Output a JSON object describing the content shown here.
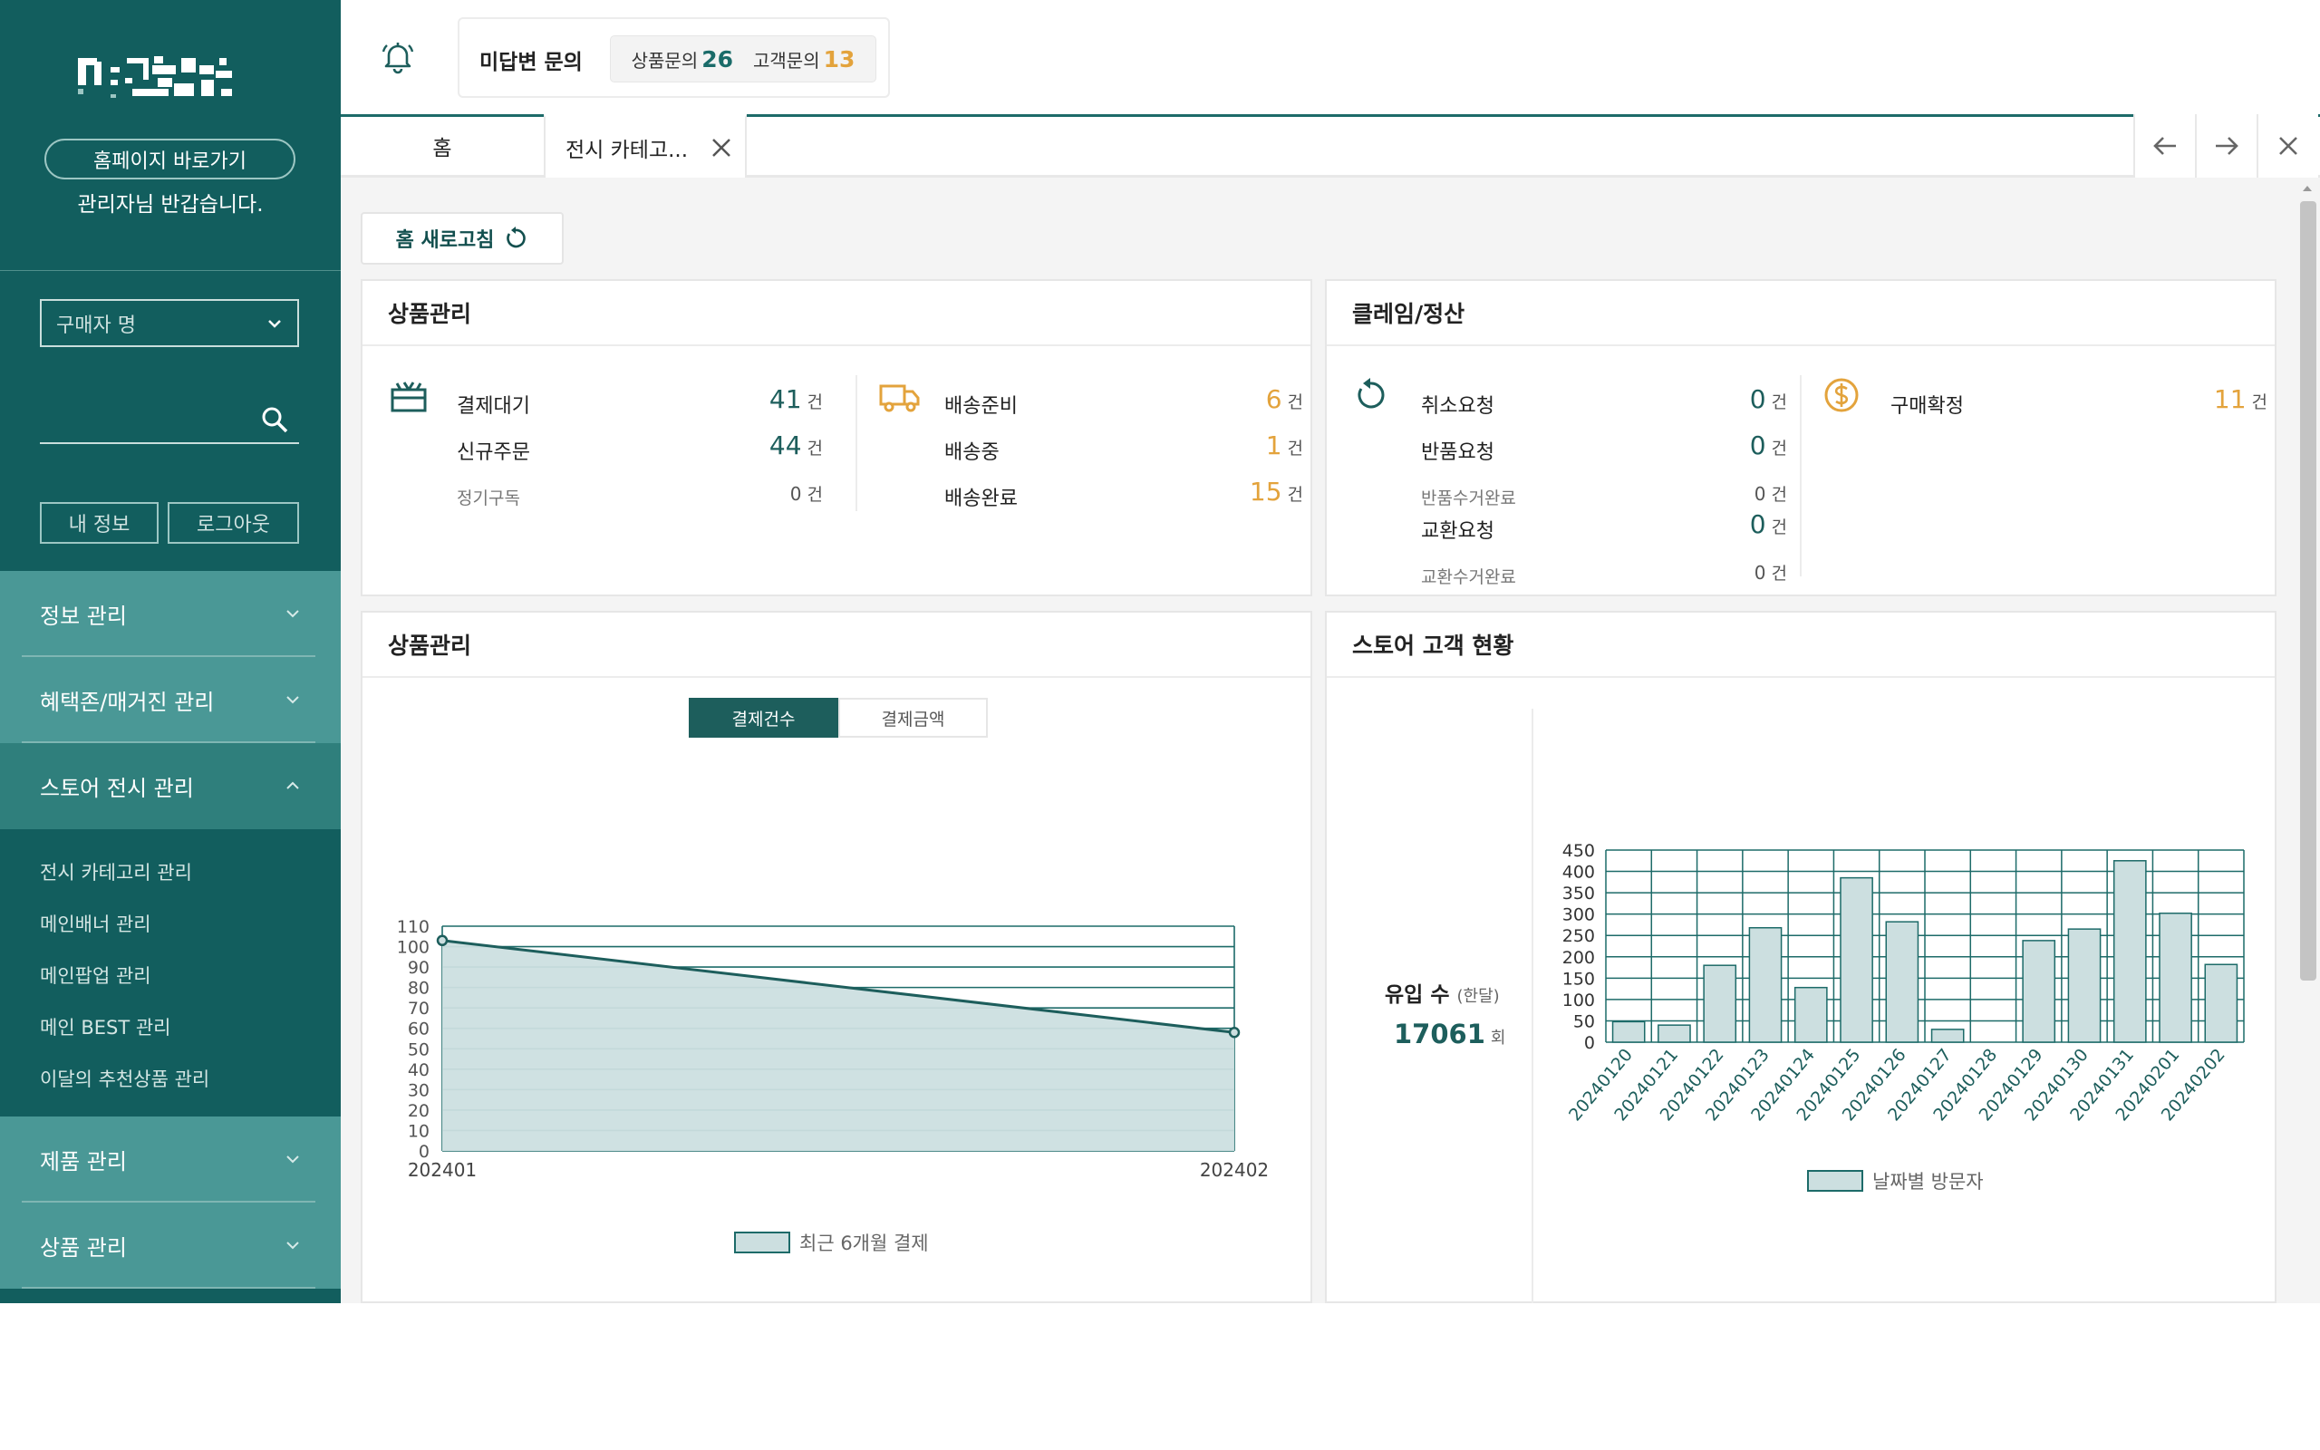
{
  "sidebar": {
    "home_link": "홈페이지 바로가기",
    "welcome": "관리자님 반갑습니다.",
    "buyer_select": "구매자 명",
    "my_info": "내 정보",
    "logout": "로그아웃",
    "menu": [
      {
        "label": "정보 관리",
        "expanded": false
      },
      {
        "label": "혜택존/매거진 관리",
        "expanded": false
      },
      {
        "label": "스토어 전시 관리",
        "expanded": true,
        "children": [
          "전시 카테고리 관리",
          "메인배너 관리",
          "메인팝업 관리",
          "메인 BEST 관리",
          "이달의 추천상품 관리"
        ]
      },
      {
        "label": "제품 관리",
        "expanded": false
      },
      {
        "label": "상품 관리",
        "expanded": false
      }
    ]
  },
  "topbar": {
    "unanswered_title": "미답변 문의",
    "product_inquiry_label": "상품문의",
    "product_inquiry_count": "26",
    "customer_inquiry_label": "고객문의",
    "customer_inquiry_count": "13"
  },
  "tabs": {
    "home": "홈",
    "category": "전시 카테고..."
  },
  "refresh_label": "홈 새로고침",
  "product_card": {
    "title": "상품관리",
    "unit": "건",
    "rows": [
      {
        "label": "결제대기",
        "value": "41"
      },
      {
        "label": "신규주문",
        "value": "44"
      },
      {
        "label": "정기구독",
        "value": "0"
      }
    ],
    "shipping": [
      {
        "label": "배송준비",
        "value": "6"
      },
      {
        "label": "배송중",
        "value": "1"
      },
      {
        "label": "배송완료",
        "value": "15"
      }
    ]
  },
  "claim_card": {
    "title": "클레임/정산",
    "unit": "건",
    "rows": [
      {
        "label": "취소요청",
        "value": "0"
      },
      {
        "label": "반품요청",
        "value": "0"
      },
      {
        "label": "반품수거완료",
        "value": "0"
      },
      {
        "label": "교환요청",
        "value": "0"
      },
      {
        "label": "교환수거완료",
        "value": "0"
      }
    ],
    "confirm": {
      "label": "구매확정",
      "value": "11"
    }
  },
  "payment_chart_card": {
    "title": "상품관리",
    "toggle": [
      "결제건수",
      "결제금액"
    ],
    "legend": "최근 6개월 결제"
  },
  "store_card": {
    "title": "스토어 고객 현황",
    "inflow_label": "유입 수",
    "inflow_period": "(한달)",
    "inflow_value": "17061",
    "inflow_unit": "회",
    "legend": "날짜별 방문자"
  },
  "colors": {
    "sidebar": "#125e5e",
    "menu_group": "#4a9896",
    "accent": "#1d5e5c",
    "orange": "#e3a33c",
    "fill": "#ccdfe0"
  },
  "chart_data": [
    {
      "type": "area",
      "title": "",
      "x": [
        "202401",
        "202402"
      ],
      "series": [
        {
          "name": "최근 6개월 결제",
          "values": [
            103,
            58
          ]
        }
      ],
      "ylim": [
        0,
        110
      ],
      "yticks": [
        0,
        10,
        20,
        30,
        40,
        50,
        60,
        70,
        80,
        90,
        100,
        110
      ],
      "grid": true,
      "legend": "bottom"
    },
    {
      "type": "bar",
      "title": "",
      "categories": [
        "20240120",
        "20240121",
        "20240122",
        "20240123",
        "20240124",
        "20240125",
        "20240126",
        "20240127",
        "20240128",
        "20240129",
        "20240130",
        "20240131",
        "20240201",
        "20240202"
      ],
      "series": [
        {
          "name": "날짜별 방문자",
          "values": [
            48,
            40,
            180,
            268,
            128,
            385,
            282,
            30,
            0,
            238,
            265,
            425,
            302,
            182
          ]
        }
      ],
      "ylim": [
        0,
        450
      ],
      "yticks": [
        0,
        50,
        100,
        150,
        200,
        250,
        300,
        350,
        400,
        450
      ],
      "grid": true,
      "legend": "bottom"
    }
  ]
}
